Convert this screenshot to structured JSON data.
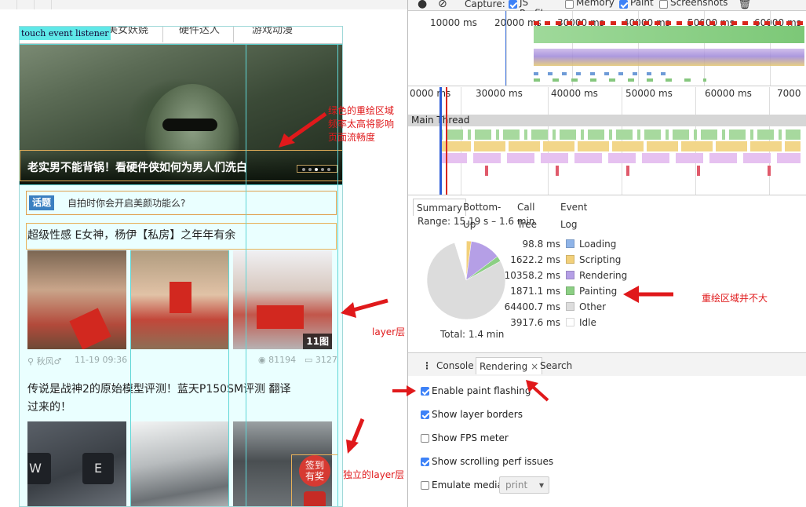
{
  "phone": {
    "overlay_label": "touch event listener",
    "tabs": [
      "美女妖娆",
      "硬件达人",
      "游戏动漫"
    ],
    "banner_caption": "老实男不能背锅！看硬件侠如何为男人们洗白",
    "topic_tag": "话题",
    "topic_text": "自拍时你会开启美颜功能么?",
    "post1": {
      "title": "超级性感 E女神，杨伊【私房】之年年有余",
      "badge": "11图",
      "author": "秋风♂",
      "time": "11-19 09:36",
      "views": "81194",
      "comments": "3127"
    },
    "post2": {
      "title_line1": "传说是战神2的原始模型评测！蓝天P150SM评测 翻译",
      "title_line2": "过来的！",
      "keys": [
        "W",
        "E"
      ]
    },
    "sign_in_line1": "签到",
    "sign_in_line2": "有奖"
  },
  "annotations": {
    "banner_note": [
      "绿色的重绘区域",
      "频率太高将影响",
      "页面流畅度"
    ],
    "layer_note": "layer层",
    "independent_layer_note": "独立的layer层",
    "small_repaint_note": "重绘区域并不大"
  },
  "devtools": {
    "capture_label": "Capture:",
    "capture_options": [
      {
        "label": "JS Profile",
        "checked": true
      },
      {
        "label": "Memory",
        "checked": false
      },
      {
        "label": "Paint",
        "checked": true
      },
      {
        "label": "Screenshots",
        "checked": false
      }
    ],
    "overview_ticks": [
      "10000 ms",
      "20000 ms",
      "30000 ms",
      "40000 ms",
      "50000 ms",
      "60000 ms"
    ],
    "flame_ticks": [
      "0000 ms",
      "30000 ms",
      "40000 ms",
      "50000 ms",
      "60000 ms",
      "7000"
    ],
    "main_thread": "Main Thread",
    "summary_tabs": [
      "Summary",
      "Bottom-Up",
      "Call Tree",
      "Event Log"
    ],
    "range": "Range: 15.19 s – 1.6 min",
    "total": "Total: 1.4 min",
    "legend": [
      {
        "value": "98.8 ms",
        "name": "Loading",
        "color": "#8fb4e8"
      },
      {
        "value": "1622.2 ms",
        "name": "Scripting",
        "color": "#f2d07a"
      },
      {
        "value": "10358.2 ms",
        "name": "Rendering",
        "color": "#b59fe6"
      },
      {
        "value": "1871.1 ms",
        "name": "Painting",
        "color": "#8ccf84"
      },
      {
        "value": "64400.7 ms",
        "name": "Other",
        "color": "#dddddd"
      },
      {
        "value": "3917.6 ms",
        "name": "Idle",
        "color": "#ffffff"
      }
    ],
    "drawer_tabs": [
      "Console",
      "Rendering",
      "Search"
    ],
    "rendering_options": [
      {
        "label": "Enable paint flashing",
        "checked": true
      },
      {
        "label": "Show layer borders",
        "checked": true
      },
      {
        "label": "Show FPS meter",
        "checked": false
      },
      {
        "label": "Show scrolling perf issues",
        "checked": true
      },
      {
        "label": "Emulate media",
        "checked": false
      }
    ],
    "emulate_media_value": "print"
  }
}
